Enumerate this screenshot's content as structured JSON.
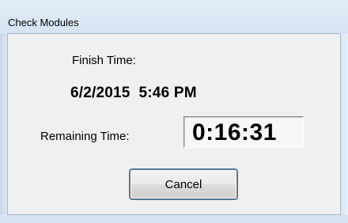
{
  "window": {
    "title": "Check Modules"
  },
  "dialog": {
    "finish_time_label": "Finish Time:",
    "finish_time_value": "6/2/2015  5:46 PM",
    "remaining_time_label": "Remaining Time:",
    "remaining_time_value": "0:16:31",
    "cancel_label": "Cancel"
  }
}
